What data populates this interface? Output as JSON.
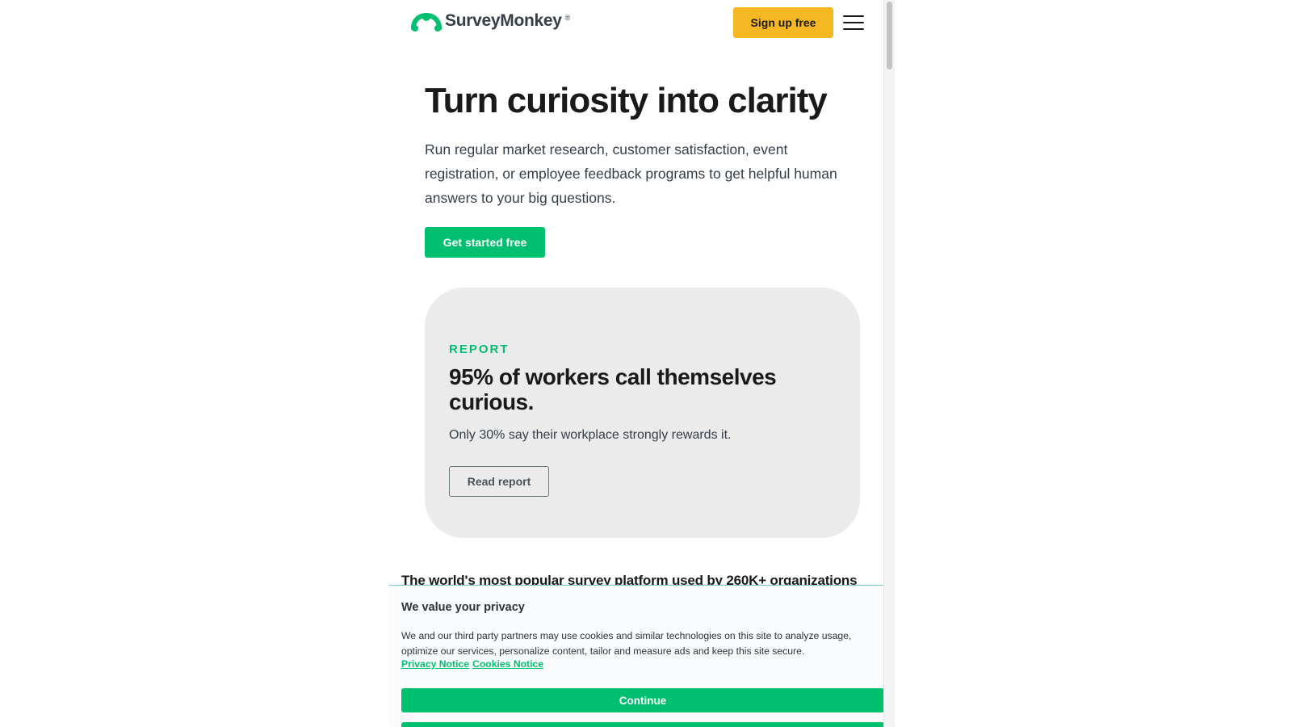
{
  "header": {
    "logo_text": "SurveyMonkey",
    "logo_mark": "®",
    "signup_label": "Sign up free",
    "menu_icon": "hamburger-icon"
  },
  "hero": {
    "title": "Turn curiosity into clarity",
    "subtitle": "Run regular market research, customer satisfaction, event registration, or employee feedback programs to get helpful human answers to your big questions.",
    "cta_label": "Get started free"
  },
  "report": {
    "eyebrow": "REPORT",
    "title": "95% of workers call themselves curious.",
    "subtitle": "Only 30% say their workplace strongly rewards it.",
    "button_label": "Read report"
  },
  "partial_heading": "The world's most popular survey platform used by 260K+ organizations",
  "cookie": {
    "title": "We value your privacy",
    "text": "We and our third party partners may use cookies and similar technologies on this site to analyze usage, optimize our services, personalize content, tailor and measure ads and keep this site secure.",
    "privacy_link": "Privacy Notice",
    "cookies_link": "Cookies Notice",
    "continue_label": "Continue"
  },
  "colors": {
    "brand_green": "#00bf6f",
    "signup_yellow": "#f5b822",
    "card_gray": "#ebebeb",
    "text_dark": "#1a1a1a"
  }
}
